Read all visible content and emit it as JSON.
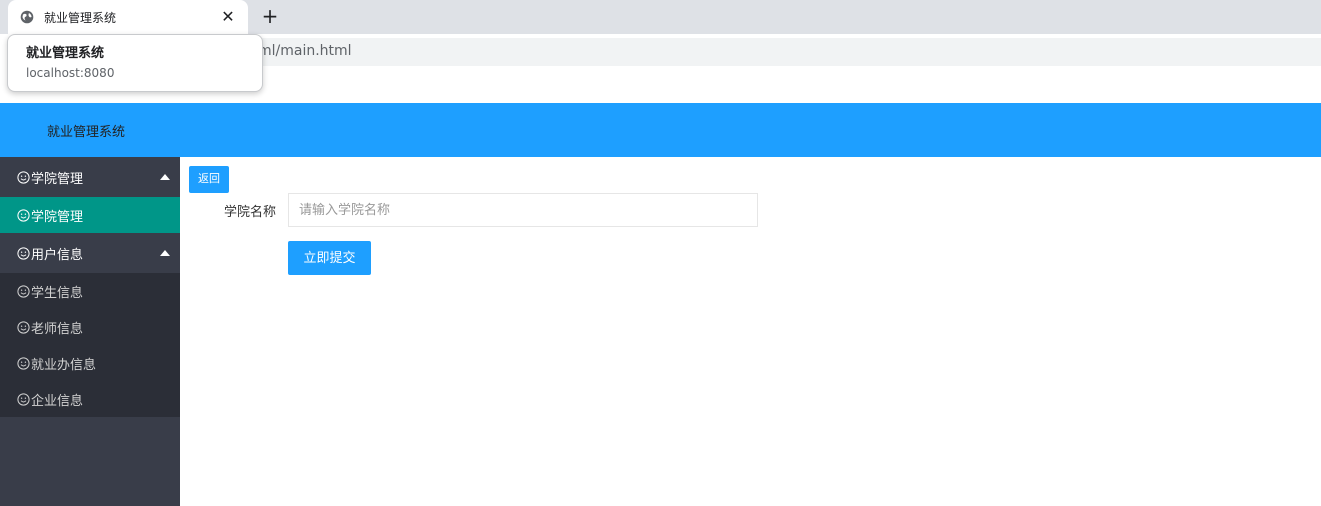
{
  "browser": {
    "tab_title": "就业管理系统",
    "close_glyph": "✕",
    "new_tab_glyph": "+",
    "url_visible": "ml/main.html",
    "tooltip": {
      "title": "就业管理系统",
      "host": "localhost:8080"
    }
  },
  "header": {
    "brand": "就业管理系统"
  },
  "sidebar": {
    "groups": [
      {
        "label": "学院管理",
        "expanded": true,
        "children": [
          {
            "label": "学院管理",
            "active": true
          }
        ]
      },
      {
        "label": "用户信息",
        "expanded": true,
        "children": [
          {
            "label": "学生信息"
          },
          {
            "label": "老师信息"
          },
          {
            "label": "就业办信息"
          },
          {
            "label": "企业信息"
          }
        ]
      }
    ]
  },
  "main": {
    "back_label": "返回",
    "form": {
      "college_name_label": "学院名称",
      "college_name_value": "",
      "college_name_placeholder": "请输入学院名称",
      "submit_label": "立即提交"
    }
  },
  "colors": {
    "header": "#1e9fff",
    "sidebar": "#393d49",
    "sidebar_child": "#2b2e37",
    "active": "#009688",
    "button": "#1e9fff"
  }
}
